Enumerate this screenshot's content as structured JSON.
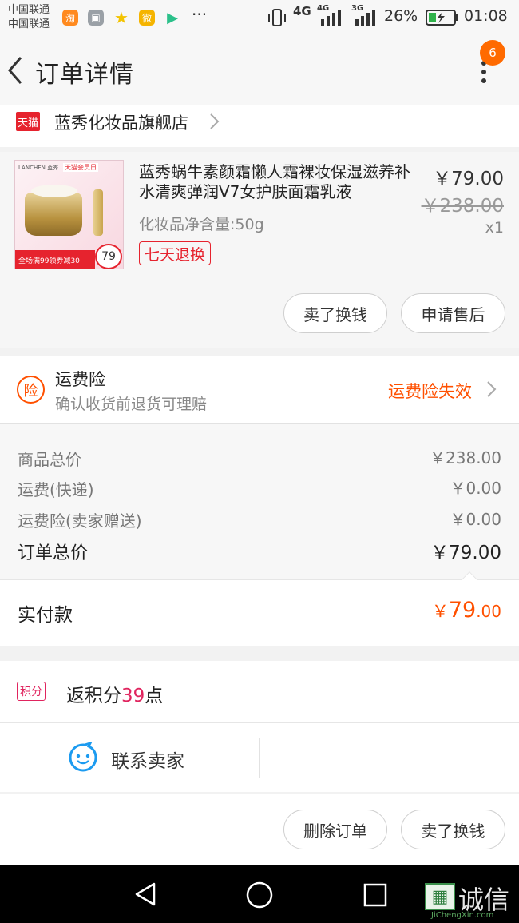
{
  "status_bar": {
    "carrier1": "中国联通",
    "carrier2": "中国联通",
    "net1": "4G",
    "net2": "4G",
    "net3": "3G",
    "battery": "26%",
    "time": "01:08",
    "more": "···"
  },
  "header": {
    "title": "订单详情",
    "badge": "6"
  },
  "shop": {
    "badge": "天猫",
    "name": "蓝秀化妆品旗舰店"
  },
  "product": {
    "image_brand": "LANCHEN 蓝秀",
    "image_tag": "天猫会员日",
    "image_banner": "全场满99领券减30",
    "image_badge": "79",
    "title": "蓝秀蜗牛素颜霜懒人霜裸妆保湿滋养补水清爽弹润V7女护肤面霜乳液",
    "spec": "化妆品净含量:50g",
    "price": "￥79.00",
    "original_price": "￥238.00",
    "quantity": "x1",
    "return_tag": "七天退换"
  },
  "product_actions": {
    "sell_label": "卖了换钱",
    "aftersale_label": "申请售后"
  },
  "insurance": {
    "icon_text": "险",
    "title": "运费险",
    "subtitle": "确认收货前退货可理赔",
    "status": "运费险失效"
  },
  "summary": {
    "rows": [
      {
        "label": "商品总价",
        "value": "￥238.00"
      },
      {
        "label": "运费(快递)",
        "value": "￥0.00"
      },
      {
        "label": "运费险(卖家赠送)",
        "value": "￥0.00"
      }
    ],
    "total_label": "订单总价",
    "total_value": "￥79.00",
    "paid_label": "实付款",
    "paid_symbol": "￥",
    "paid_int": "79",
    "paid_dec": ".00"
  },
  "points": {
    "tag": "积分",
    "prefix": "返积分",
    "value": "39",
    "suffix": "点"
  },
  "contact": {
    "label": "联系卖家"
  },
  "footer": {
    "delete_label": "删除订单",
    "sell_label": "卖了换钱"
  },
  "watermark": {
    "text": "诚信",
    "sub": "JiChengXin.com"
  },
  "colors": {
    "accent": "#ff5000",
    "tmall_red": "#e6232e",
    "points_red": "#e0245e",
    "contact_blue": "#1c9bf0"
  }
}
